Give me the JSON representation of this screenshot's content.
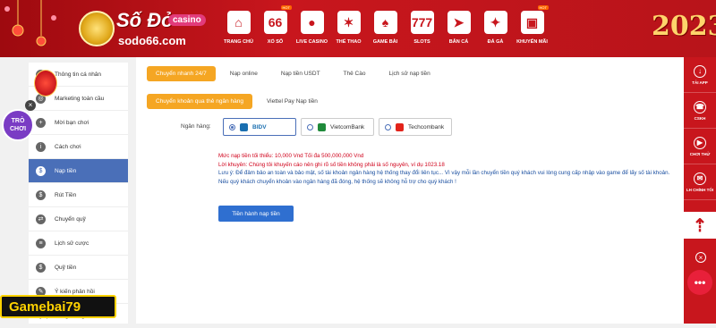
{
  "header": {
    "logo_main": "Số Đỏ",
    "logo_badge": "casino",
    "logo_sub": "sodo66.com",
    "year": "2023",
    "nav": [
      {
        "label": "TRANG CHỦ",
        "icon": "home-icon",
        "glyph": "⌂",
        "badge": ""
      },
      {
        "label": "XỔ SỐ",
        "icon": "lottery-icon",
        "glyph": "66",
        "badge": "HOT"
      },
      {
        "label": "LIVE CASINO",
        "icon": "casino-chip-icon",
        "glyph": "●",
        "badge": ""
      },
      {
        "label": "THỂ THAO",
        "icon": "sports-icon",
        "glyph": "✶",
        "badge": ""
      },
      {
        "label": "GAME BÀI",
        "icon": "cards-icon",
        "glyph": "♠",
        "badge": ""
      },
      {
        "label": "SLOTS",
        "icon": "slots-icon",
        "glyph": "777",
        "badge": ""
      },
      {
        "label": "BẮN CÁ",
        "icon": "fish-icon",
        "glyph": "➤",
        "badge": ""
      },
      {
        "label": "ĐÁ GÀ",
        "icon": "rooster-icon",
        "glyph": "✦",
        "badge": ""
      },
      {
        "label": "KHUYẾN MÃI",
        "icon": "gift-icon",
        "glyph": "▣",
        "badge": "HOT"
      }
    ]
  },
  "sidebar": {
    "items": [
      {
        "label": "Thông tin cá nhân",
        "icon": "user-icon",
        "glyph": "i",
        "active": false
      },
      {
        "label": "Marketing toàn cầu",
        "icon": "globe-icon",
        "glyph": "◎",
        "active": false
      },
      {
        "label": "Mời bạn chơi",
        "icon": "invite-icon",
        "glyph": "+",
        "active": false
      },
      {
        "label": "Cách chơi",
        "icon": "info-icon",
        "glyph": "i",
        "active": false
      },
      {
        "label": "Nạp tiền",
        "icon": "deposit-icon",
        "glyph": "$",
        "active": true
      },
      {
        "label": "Rút Tiền",
        "icon": "withdraw-icon",
        "glyph": "$",
        "active": false
      },
      {
        "label": "Chuyển quỹ",
        "icon": "transfer-icon",
        "glyph": "⇄",
        "active": false
      },
      {
        "label": "Lịch sử cược",
        "icon": "history-icon",
        "glyph": "≡",
        "active": false
      },
      {
        "label": "Quỹ tiền",
        "icon": "fund-icon",
        "glyph": "$",
        "active": false
      },
      {
        "label": "Ý kiến phản hồi",
        "icon": "feedback-icon",
        "glyph": "✎",
        "active": false
      }
    ],
    "bottom_partial": "Kỹ qua hàng thông"
  },
  "promo": {
    "label_line1": "TRÒ",
    "label_line2": "CHƠI"
  },
  "main": {
    "tabs_top": [
      {
        "label": "Chuyển nhanh 24/7",
        "active": true
      },
      {
        "label": "Nạp online",
        "active": false
      },
      {
        "label": "Nạp tiền USDT",
        "active": false
      },
      {
        "label": "Thẻ Cào",
        "active": false
      },
      {
        "label": "Lịch sử nạp tiền",
        "active": false
      }
    ],
    "tabs_sub": [
      {
        "label": "Chuyển khoản qua thẻ ngân hàng",
        "active": true
      },
      {
        "label": "Viettel Pay Nạp tiền",
        "active": false
      }
    ],
    "bank_label": "Ngân hàng:",
    "banks": [
      {
        "name": "BIDV",
        "selected": true,
        "color": "#1a6fb0"
      },
      {
        "name": "VietcomBank",
        "selected": false,
        "color": "#1f8a3a"
      },
      {
        "name": "Techcombank",
        "selected": false,
        "color": "#e2231a"
      }
    ],
    "note_limit": "Mức nạp tiền tối thiểu: 10,000 Vnd Tối đa 500,000,000 Vnd",
    "note_reminder": "Lời khuyên: Chúng tôi khuyến cáo nên ghi rõ số tiền không phải là số nguyên, ví dụ 1023.18",
    "note_warning": "Lưu ý: Để đảm bảo an toàn và bảo mật, số tài khoản ngân hàng hệ thống thay đổi liên tục... Vì vậy mỗi lần chuyển tiền quý khách vui lòng cung cấp nhập vào game để lấy số tài khoản. Nếu quý khách chuyển khoản vào ngân hàng đã đóng, hệ thống sẽ không hỗ trợ cho quý khách !",
    "submit_label": "Tiền hành nạp tiền"
  },
  "right_bar": {
    "items": [
      {
        "label": "TẢI APP",
        "icon": "download-icon",
        "glyph": "↓"
      },
      {
        "label": "CSKH",
        "icon": "support-icon",
        "glyph": "☎"
      },
      {
        "label": "CHƠI THỬ",
        "icon": "play-icon",
        "glyph": "▶"
      },
      {
        "label": "LH CHÍNH TỐI",
        "icon": "contact-icon",
        "glyph": "✉"
      }
    ],
    "up_glyph": "⇡",
    "close_glyph": "×",
    "more_glyph": "•••"
  },
  "watermark": "Gamebai79"
}
